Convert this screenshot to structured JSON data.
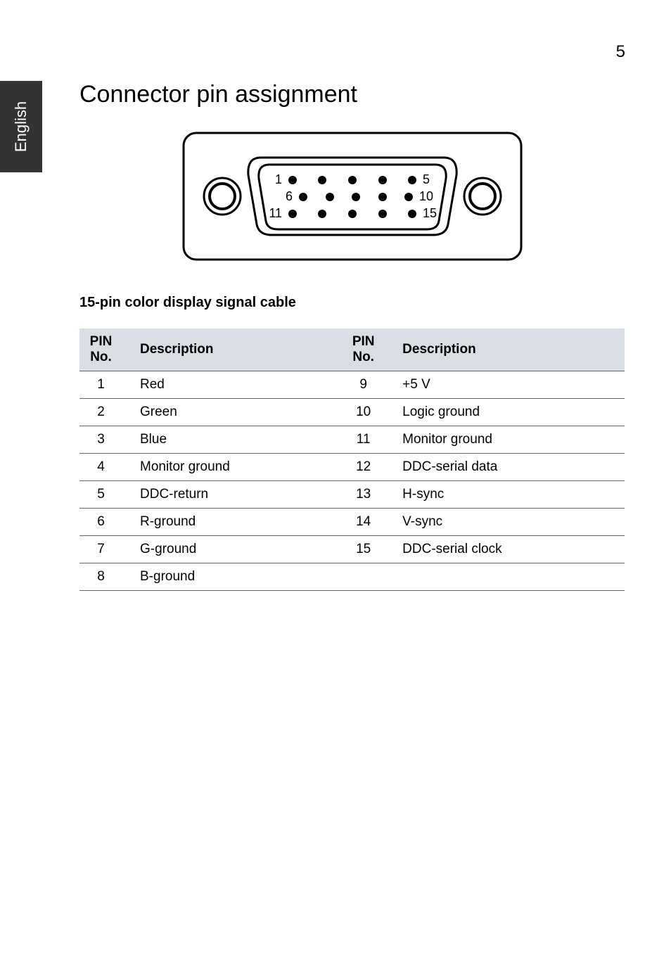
{
  "page_number": "5",
  "side_tab": "English",
  "heading": "Connector pin assignment",
  "diagram": {
    "rows": [
      {
        "left": "1",
        "right": "5"
      },
      {
        "left": "6",
        "right": "10"
      },
      {
        "left": "11",
        "right": "15"
      }
    ]
  },
  "caption": "15-pin color display signal cable",
  "table": {
    "headers": [
      "PIN No.",
      "Description",
      "PIN No.",
      "Description"
    ],
    "rows": [
      {
        "p1": "1",
        "d1": "Red",
        "p2": "9",
        "d2": "+5 V"
      },
      {
        "p1": "2",
        "d1": "Green",
        "p2": "10",
        "d2": "Logic ground"
      },
      {
        "p1": "3",
        "d1": "Blue",
        "p2": "11",
        "d2": "Monitor ground"
      },
      {
        "p1": "4",
        "d1": "Monitor ground",
        "p2": "12",
        "d2": "DDC-serial data"
      },
      {
        "p1": "5",
        "d1": "DDC-return",
        "p2": "13",
        "d2": "H-sync"
      },
      {
        "p1": "6",
        "d1": "R-ground",
        "p2": "14",
        "d2": "V-sync"
      },
      {
        "p1": "7",
        "d1": "G-ground",
        "p2": "15",
        "d2": "DDC-serial clock"
      },
      {
        "p1": "8",
        "d1": "B-ground",
        "p2": "",
        "d2": ""
      }
    ]
  }
}
